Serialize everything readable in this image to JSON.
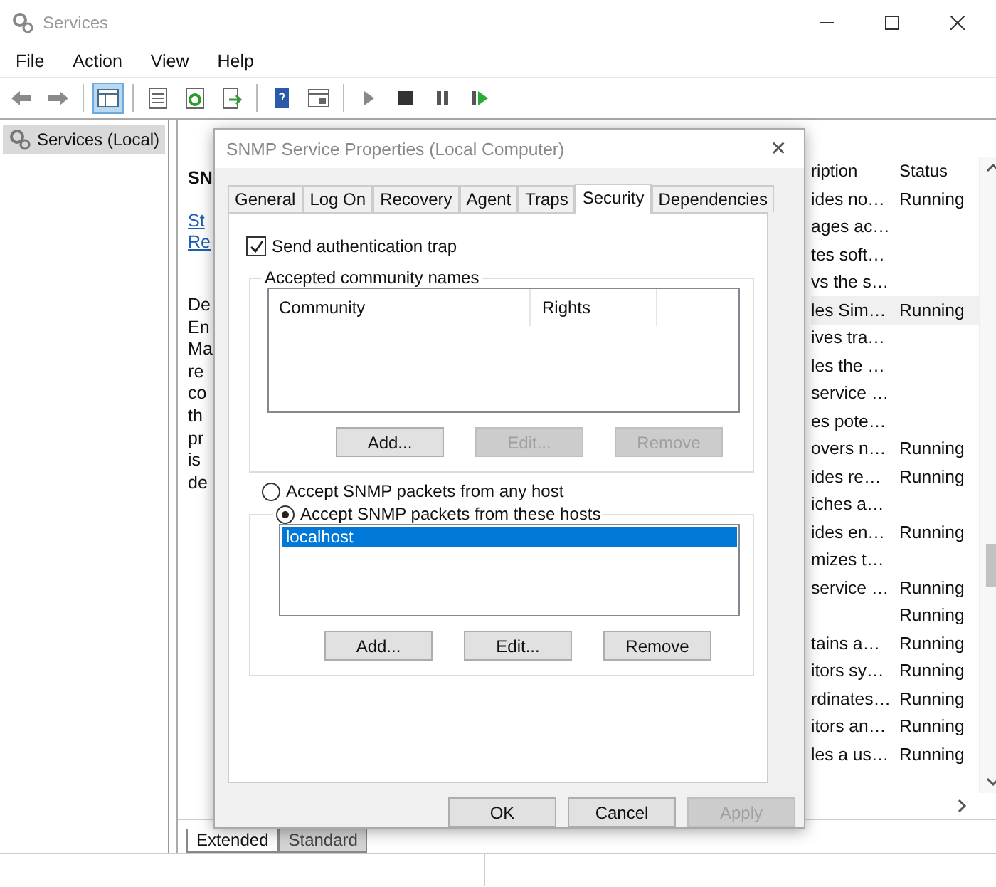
{
  "window": {
    "title": "Services"
  },
  "menu": [
    "File",
    "Action",
    "View",
    "Help"
  ],
  "toolbar": [
    {
      "kind": "back",
      "selected": false
    },
    {
      "kind": "forward",
      "selected": false
    },
    {
      "kind": "sep"
    },
    {
      "kind": "tree",
      "selected": true
    },
    {
      "kind": "sep"
    },
    {
      "kind": "properties",
      "selected": false
    },
    {
      "kind": "refresh",
      "selected": false
    },
    {
      "kind": "export",
      "selected": false
    },
    {
      "kind": "sep"
    },
    {
      "kind": "help",
      "selected": false
    },
    {
      "kind": "view",
      "selected": false
    },
    {
      "kind": "sep"
    },
    {
      "kind": "play",
      "selected": false
    },
    {
      "kind": "stop",
      "selected": false
    },
    {
      "kind": "pause",
      "selected": false
    },
    {
      "kind": "resume",
      "selected": false
    }
  ],
  "tree": [
    {
      "label": "Services (Local)",
      "selected": true
    }
  ],
  "details": {
    "title": "SN",
    "links": [
      "St",
      "Re"
    ],
    "description_lines": [
      "De",
      "En",
      "Ma",
      "re",
      "co",
      "th",
      "pr",
      "is",
      "de"
    ]
  },
  "list": {
    "columns": [
      "ription",
      "Status"
    ],
    "rows": [
      {
        "description": "ides no…",
        "status": "Running",
        "selected": false
      },
      {
        "description": "ages ac…",
        "status": "",
        "selected": false
      },
      {
        "description": "tes soft…",
        "status": "",
        "selected": false
      },
      {
        "description": "vs the s…",
        "status": "",
        "selected": false
      },
      {
        "description": "les Sim…",
        "status": "Running",
        "selected": true
      },
      {
        "description": "ives tra…",
        "status": "",
        "selected": false
      },
      {
        "description": "les the …",
        "status": "",
        "selected": false
      },
      {
        "description": "service …",
        "status": "",
        "selected": false
      },
      {
        "description": "es pote…",
        "status": "",
        "selected": false
      },
      {
        "description": "overs n…",
        "status": "Running",
        "selected": false
      },
      {
        "description": "ides re…",
        "status": "Running",
        "selected": false
      },
      {
        "description": "iches a…",
        "status": "",
        "selected": false
      },
      {
        "description": "ides en…",
        "status": "Running",
        "selected": false
      },
      {
        "description": "mizes t…",
        "status": "",
        "selected": false
      },
      {
        "description": "service …",
        "status": "Running",
        "selected": false
      },
      {
        "description": "",
        "status": "Running",
        "selected": false
      },
      {
        "description": "tains a…",
        "status": "Running",
        "selected": false
      },
      {
        "description": "itors sy…",
        "status": "Running",
        "selected": false
      },
      {
        "description": "rdinates…",
        "status": "Running",
        "selected": false
      },
      {
        "description": "itors an…",
        "status": "Running",
        "selected": false
      },
      {
        "description": "les a us…",
        "status": "Running",
        "selected": false
      }
    ]
  },
  "view_tabs": [
    {
      "label": "Extended",
      "selected": true
    },
    {
      "label": "Standard",
      "selected": false
    }
  ],
  "dialog": {
    "title": "SNMP Service Properties (Local Computer)",
    "close": "✕",
    "tabs": [
      {
        "label": "General",
        "selected": false
      },
      {
        "label": "Log On",
        "selected": false
      },
      {
        "label": "Recovery",
        "selected": false
      },
      {
        "label": "Agent",
        "selected": false
      },
      {
        "label": "Traps",
        "selected": false
      },
      {
        "label": "Security",
        "selected": true
      },
      {
        "label": "Dependencies",
        "selected": false
      }
    ],
    "auth_trap": {
      "label": "Send authentication trap",
      "checked": true
    },
    "community": {
      "title": "Accepted community names",
      "columns": [
        "Community",
        "Rights"
      ],
      "buttons": [
        {
          "label": "Add...",
          "disabled": false
        },
        {
          "label": "Edit...",
          "disabled": true
        },
        {
          "label": "Remove",
          "disabled": true
        }
      ]
    },
    "host_options": [
      {
        "label": "Accept SNMP packets from any host",
        "selected": false
      },
      {
        "label": "Accept SNMP packets from these hosts",
        "selected": true
      }
    ],
    "hosts": [
      {
        "name": "localhost",
        "selected": true
      }
    ],
    "host_buttons": [
      {
        "label": "Add...",
        "disabled": false
      },
      {
        "label": "Edit...",
        "disabled": false
      },
      {
        "label": "Remove",
        "disabled": false
      }
    ],
    "footer_buttons": [
      {
        "label": "OK",
        "disabled": false
      },
      {
        "label": "Cancel",
        "disabled": false
      },
      {
        "label": "Apply",
        "disabled": true
      }
    ]
  }
}
